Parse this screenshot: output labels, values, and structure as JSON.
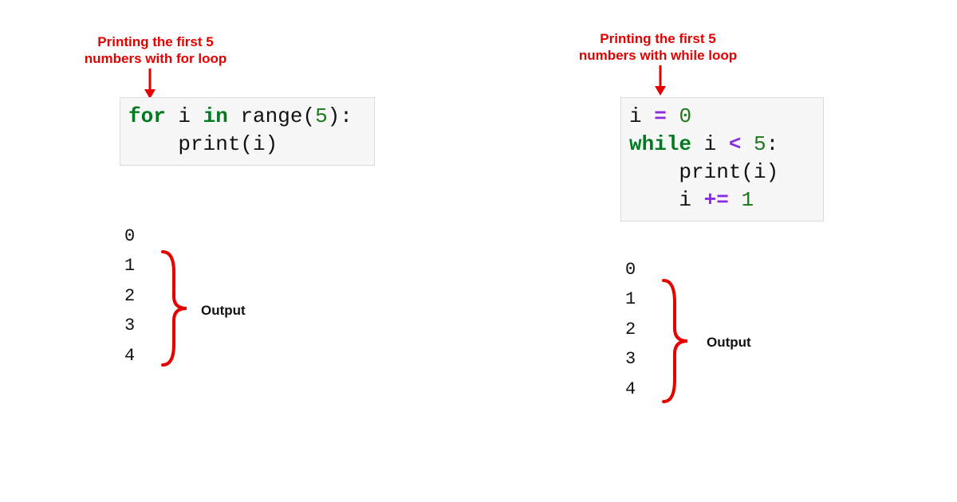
{
  "left": {
    "caption": "Printing the first 5\nnumbers with for loop",
    "code_tokens": [
      {
        "t": "for",
        "cls": "kw"
      },
      {
        "t": " i ",
        "cls": "ident"
      },
      {
        "t": "in",
        "cls": "kw"
      },
      {
        "t": " range(",
        "cls": "builtin"
      },
      {
        "t": "5",
        "cls": "num"
      },
      {
        "t": "):",
        "cls": "builtin"
      },
      {
        "t": "\n",
        "cls": ""
      },
      {
        "t": "    print(i)",
        "cls": "builtin"
      }
    ],
    "output_lines": [
      "0",
      "1",
      "2",
      "3",
      "4"
    ],
    "output_label": "Output"
  },
  "right": {
    "caption": "Printing the first 5\nnumbers with while loop",
    "code_tokens": [
      {
        "t": "i ",
        "cls": "ident"
      },
      {
        "t": "=",
        "cls": "op"
      },
      {
        "t": " ",
        "cls": ""
      },
      {
        "t": "0",
        "cls": "num"
      },
      {
        "t": "\n",
        "cls": ""
      },
      {
        "t": "while",
        "cls": "kw"
      },
      {
        "t": " i ",
        "cls": "ident"
      },
      {
        "t": "<",
        "cls": "op"
      },
      {
        "t": " ",
        "cls": ""
      },
      {
        "t": "5",
        "cls": "num"
      },
      {
        "t": ":",
        "cls": "builtin"
      },
      {
        "t": "\n",
        "cls": ""
      },
      {
        "t": "    print(i)",
        "cls": "builtin"
      },
      {
        "t": "\n",
        "cls": ""
      },
      {
        "t": "    i ",
        "cls": "ident"
      },
      {
        "t": "+=",
        "cls": "op"
      },
      {
        "t": " ",
        "cls": ""
      },
      {
        "t": "1",
        "cls": "num"
      }
    ],
    "output_lines": [
      "0",
      "1",
      "2",
      "3",
      "4"
    ],
    "output_label": "Output"
  },
  "colors": {
    "annotation": "#e60000",
    "code_bg": "#f7f7f7"
  }
}
